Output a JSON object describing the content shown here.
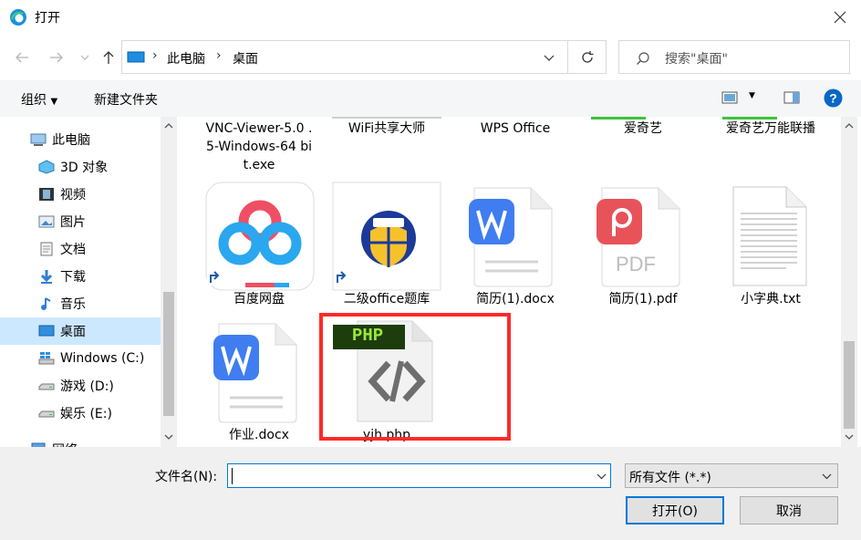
{
  "window": {
    "title": "打开"
  },
  "address": {
    "path": [
      "此电脑",
      "桌面"
    ]
  },
  "search": {
    "placeholder": "搜索\"桌面\""
  },
  "commandbar": {
    "organize": "组织",
    "new_folder": "新建文件夹"
  },
  "nav": {
    "items": [
      {
        "label": "此电脑",
        "icon": "computer-icon"
      },
      {
        "label": "3D 对象",
        "icon": "cube-icon"
      },
      {
        "label": "视频",
        "icon": "film-icon"
      },
      {
        "label": "图片",
        "icon": "picture-icon"
      },
      {
        "label": "文档",
        "icon": "document-icon"
      },
      {
        "label": "下载",
        "icon": "download-arrow-icon"
      },
      {
        "label": "音乐",
        "icon": "music-note-icon"
      },
      {
        "label": "桌面",
        "icon": "desktop-icon"
      },
      {
        "label": "Windows (C:)",
        "icon": "windows-drive-icon"
      },
      {
        "label": "游戏 (D:)",
        "icon": "drive-icon"
      },
      {
        "label": "娱乐 (E:)",
        "icon": "drive-icon"
      },
      {
        "label": "网络",
        "icon": "network-icon"
      }
    ]
  },
  "files": {
    "row0": [
      {
        "label": "VNC-Viewer-5.0 .5-Windows-64 bit.exe"
      },
      {
        "label": "WiFi共享大师"
      },
      {
        "label": "WPS Office"
      },
      {
        "label": "爱奇艺"
      },
      {
        "label": "爱奇艺万能联播"
      }
    ],
    "row1": [
      {
        "label": "百度网盘",
        "icon": "baidu-netdisk-icon"
      },
      {
        "label": "二级office题库",
        "icon": "future-office-icon"
      },
      {
        "label": "简历(1).docx",
        "icon": "wps-word-icon"
      },
      {
        "label": "简历(1).pdf",
        "icon": "wps-pdf-icon",
        "pdf_text": "PDF"
      },
      {
        "label": "小字典.txt",
        "icon": "text-file-icon"
      }
    ],
    "row2": [
      {
        "label": "作业.docx",
        "icon": "wps-word-icon"
      },
      {
        "label": "yjh.php",
        "icon": "php-file-icon",
        "badge": "PHP"
      }
    ]
  },
  "bottom": {
    "filename_label": "文件名(N):",
    "filename_value": "",
    "filetype_value": "所有文件 (*.*)",
    "open_button": "打开(O)",
    "cancel_button": "取消"
  },
  "colors": {
    "accent": "#0078d7",
    "highlight": "#ff2a2a",
    "selected_bg": "#cce8ff"
  }
}
